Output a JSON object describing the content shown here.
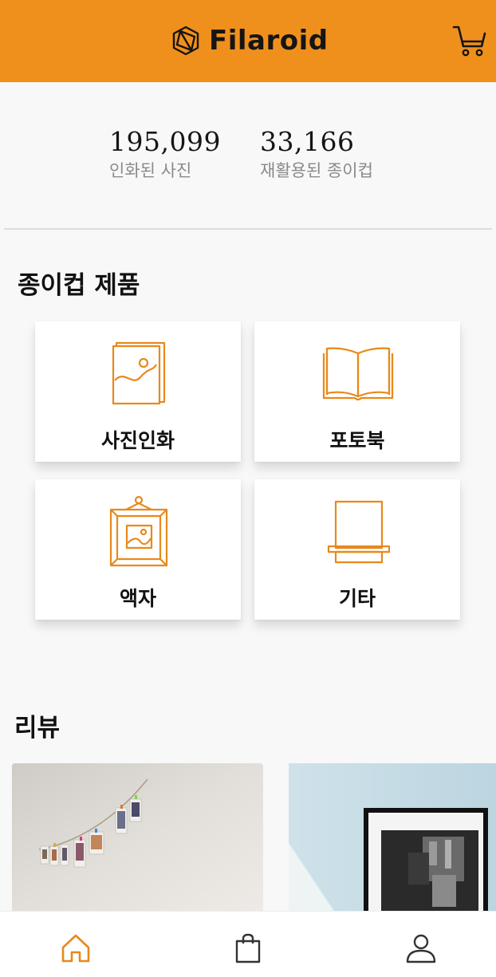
{
  "header": {
    "brand": "Filaroid",
    "logo_icon": "hexagon-logo-icon",
    "cart_icon": "cart-icon"
  },
  "stats": [
    {
      "value": "195,099",
      "label": "인화된 사진"
    },
    {
      "value": "33,166",
      "label": "재활용된 종이컵"
    }
  ],
  "products": {
    "title": "종이컵 제품",
    "items": [
      {
        "label": "사진인화",
        "icon": "photo-print-icon"
      },
      {
        "label": "포토북",
        "icon": "photobook-icon"
      },
      {
        "label": "액자",
        "icon": "frame-icon"
      },
      {
        "label": "기타",
        "icon": "shelf-icon"
      }
    ]
  },
  "reviews": {
    "title": "리뷰"
  },
  "nav": {
    "items": [
      "home-icon",
      "shopping-bag-icon",
      "profile-icon"
    ]
  },
  "colors": {
    "accent": "#f0901c",
    "icon": "#e8891a"
  }
}
